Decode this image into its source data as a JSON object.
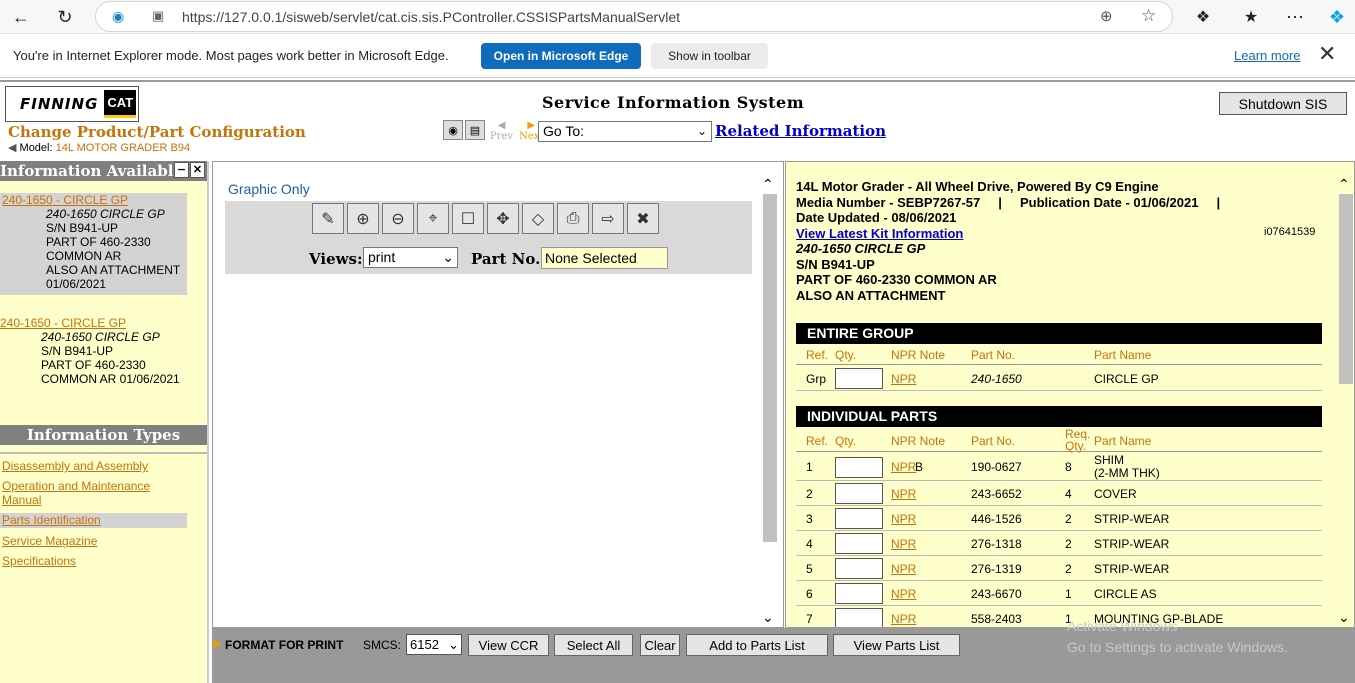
{
  "browser": {
    "url": "https://127.0.0.1/sisweb/servlet/cat.cis.sis.PController.CSSISPartsManualServlet"
  },
  "iebar": {
    "message": "You're in Internet Explorer mode. Most pages work better in Microsoft Edge.",
    "open_edge": "Open in Microsoft Edge",
    "show_toolbar": "Show in toolbar",
    "learn_more": "Learn more"
  },
  "header": {
    "logo_finning": "FINNING",
    "logo_cat": "CAT",
    "title": "Service Information System",
    "change_product": "Change Product/Part Configuration",
    "model_label": "Model:",
    "model_value": "14L MOTOR GRADER B94",
    "prev": "Prev",
    "next": "Next",
    "goto": "Go To:",
    "related": "Related Information",
    "shutdown": "Shutdown SIS"
  },
  "left": {
    "info_available": "Information Available",
    "entries": [
      {
        "link": "240-1650 - CIRCLE GP",
        "lines": [
          "240-1650 CIRCLE GP",
          "S/N B941-UP",
          "PART OF 460-2330",
          "COMMON AR",
          "ALSO AN ATTACHMENT",
          "01/06/2021"
        ]
      },
      {
        "link": "240-1650 - CIRCLE GP",
        "lines": [
          "240-1650 CIRCLE GP",
          "S/N B941-UP",
          "PART OF 460-2330",
          "COMMON AR 01/06/2021"
        ]
      }
    ],
    "info_types": "Information Types",
    "types": [
      "Disassembly and Assembly",
      "Operation and Maintenance Manual",
      "Parts Identification",
      "Service Magazine",
      "Specifications"
    ]
  },
  "middle": {
    "graphic_only": "Graphic Only",
    "views_label": "Views:",
    "views_value": "print",
    "part_label": "Part No.:",
    "part_value": "None Selected"
  },
  "right": {
    "title_lines": [
      "14L Motor Grader - All Wheel Drive, Powered By C9 Engine",
      "Media Number - SEBP7267-57     |     Publication Date - 01/06/2021     |",
      "Date Updated - 08/06/2021"
    ],
    "kit_link": "View Latest Kit Information",
    "image_id": "i07641539",
    "part_desc": [
      "240-1650 CIRCLE GP",
      "S/N B941-UP",
      "PART OF 460-2330 COMMON AR",
      "ALSO AN ATTACHMENT"
    ],
    "entire_group": "ENTIRE GROUP",
    "individual_parts": "INDIVIDUAL PARTS",
    "cols": {
      "ref": "Ref.",
      "qty": "Qty.",
      "npr": "NPR Note",
      "partno": "Part No.",
      "req": "Req.",
      "req2": "Qty.",
      "name": "Part Name"
    },
    "group_row": {
      "ref": "Grp",
      "npr": "NPR",
      "partno": "240-1650",
      "name": "CIRCLE GP"
    },
    "parts": [
      {
        "ref": "1",
        "npr": "NPR",
        "note": "B",
        "partno": "190-0627",
        "req": "8",
        "name": "SHIM",
        "name2": "(2-MM THK)"
      },
      {
        "ref": "2",
        "npr": "NPR",
        "note": "",
        "partno": "243-6652",
        "req": "4",
        "name": "COVER",
        "name2": ""
      },
      {
        "ref": "3",
        "npr": "NPR",
        "note": "",
        "partno": "446-1526",
        "req": "2",
        "name": "STRIP-WEAR",
        "name2": ""
      },
      {
        "ref": "4",
        "npr": "NPR",
        "note": "",
        "partno": "276-1318",
        "req": "2",
        "name": "STRIP-WEAR",
        "name2": ""
      },
      {
        "ref": "5",
        "npr": "NPR",
        "note": "",
        "partno": "276-1319",
        "req": "2",
        "name": "STRIP-WEAR",
        "name2": ""
      },
      {
        "ref": "6",
        "npr": "NPR",
        "note": "",
        "partno": "243-6670",
        "req": "1",
        "name": "CIRCLE AS",
        "name2": ""
      },
      {
        "ref": "7",
        "npr": "NPR",
        "note": "",
        "partno": "558-2403",
        "req": "1",
        "name": "MOUNTING GP-BLADE",
        "name2": ""
      }
    ]
  },
  "bottom": {
    "format": "FORMAT FOR PRINT",
    "smcs_label": "SMCS:",
    "smcs_value": "6152",
    "view_ccr": "View CCR",
    "select_all": "Select All",
    "clear": "Clear",
    "add_parts": "Add to Parts List",
    "view_parts": "View Parts List",
    "watermark1": "Activate Windows",
    "watermark2": "Go to Settings to activate Windows."
  }
}
